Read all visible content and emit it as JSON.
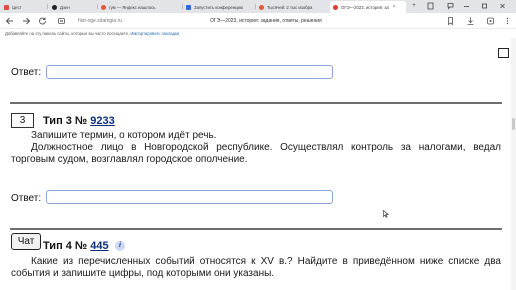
{
  "browser": {
    "tabs": [
      {
        "title": "Цест",
        "color": "#e04c3c"
      },
      {
        "title": "Дзен",
        "color": "#222222"
      },
      {
        "title": "гум — Яндекс нашлось",
        "color": "#e05a3a"
      },
      {
        "title": "Запустить конференцию",
        "color": "#2d6be0"
      },
      {
        "title": "Тысячей: 2 тыс изобра",
        "color": "#e05a3a"
      },
      {
        "title": "ОГЭ—2023, история: за",
        "color": "#e03b2f"
      }
    ],
    "close_glyph": "×",
    "new_tab_glyph": "+",
    "address_domain": "hist-oge.sdamgia.ru",
    "address_title": "ОГЭ—2023, история: задания, ответы, решения",
    "bookmark_text": "Добавляйте на эту панель сайты, которые вы часто посещаете.",
    "bookmark_link": "Импортировать закладки"
  },
  "page": {
    "answer_label": "Ответ:",
    "task3": {
      "number": "3",
      "type_text": "Тип 3 №",
      "id": "9233",
      "instruction": "Запишите термин, о котором идёт речь.",
      "body": "Должностное лицо в Новгородской республике. Осуществлял контроль за налогами, ведал торговым судом, возглавлял городское ополчение."
    },
    "task4": {
      "type_text": "Тип 4 №",
      "id": "445",
      "info_glyph": "i",
      "body": "Какие из перечисленных событий относятся к XV в.? Найдите в приведённом ниже списке два события и запишите цифры, под которыми они указаны."
    },
    "chat_label": "Чат"
  }
}
